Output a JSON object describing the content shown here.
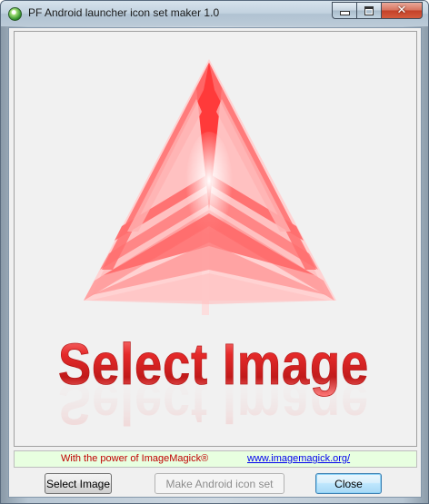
{
  "window": {
    "title": "PF Android launcher icon set maker 1.0"
  },
  "caption_buttons": {
    "minimize": "minimize",
    "maximize": "maximize",
    "close": "close"
  },
  "preview": {
    "logo_icon": "red-layered-triangle",
    "prompt_text": "Select Image",
    "accent_color": "#e83a3a"
  },
  "credits": {
    "power_text": "With the power of  ImageMagick®",
    "link_text": "www.imagemagick.org/",
    "power_color": "#c00000",
    "link_color": "#0000ee"
  },
  "buttons": {
    "select_image": "Select Image",
    "make_icon_set": "Make Android icon set",
    "close": "Close"
  }
}
